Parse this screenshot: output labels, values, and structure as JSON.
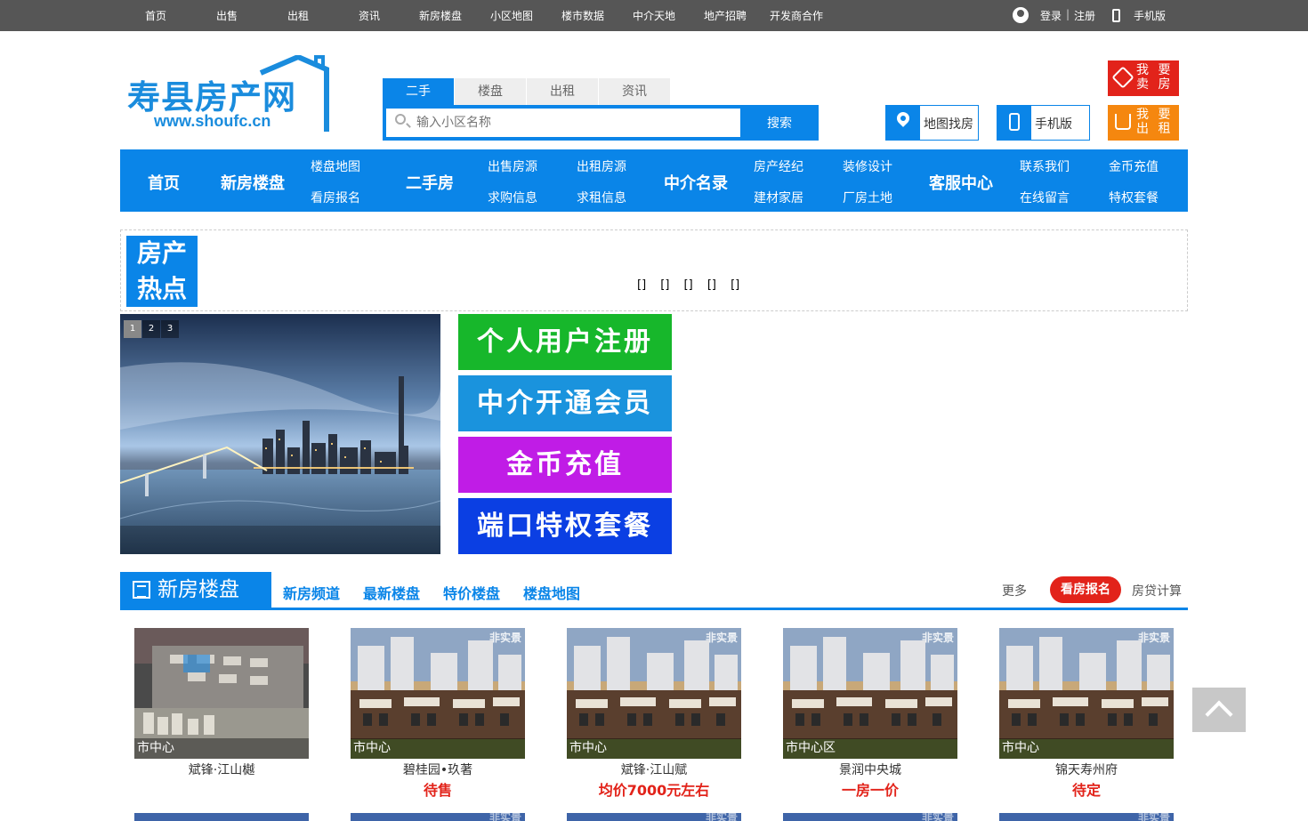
{
  "topbar": {
    "nav": [
      "首页",
      "出售",
      "出租",
      "资讯",
      "新房楼盘",
      "小区地图",
      "楼市数据",
      "中介天地",
      "地产招聘",
      "开发商合作"
    ],
    "login": "登录",
    "sep": "|",
    "register": "注册",
    "mobile": "手机版"
  },
  "logo": {
    "name": "寿县房产网",
    "url": "www.shoufc.cn"
  },
  "search": {
    "tabs": [
      "二手",
      "楼盘",
      "出租",
      "资讯"
    ],
    "active_tab": "二手",
    "placeholder": "输入小区名称",
    "button": "搜索"
  },
  "quick": {
    "map": "地图找房",
    "mobile": "手机版"
  },
  "actions": {
    "sell": [
      "我 要",
      "卖 房"
    ],
    "rent": [
      "我 要",
      "出 租"
    ]
  },
  "mainnav": {
    "home": "首页",
    "newhouse": "新房楼盘",
    "newhouse_sub": [
      "楼盘地图",
      "看房报名"
    ],
    "secondhand": "二手房",
    "secondhand_sub": [
      "出售房源",
      "求购信息",
      "出租房源",
      "求租信息"
    ],
    "agents": "中介名录",
    "agents_sub": [
      "房产经纪",
      "建材家居",
      "装修设计",
      "厂房土地"
    ],
    "service": "客服中心",
    "service_sub": [
      "联系我们",
      "在线留言",
      "金币充值",
      "特权套餐"
    ]
  },
  "hot": {
    "title_line1": "房产",
    "title_line2": "热点",
    "items": "[]  []  []  []  []"
  },
  "slider": {
    "pages": [
      "1",
      "2",
      "3"
    ]
  },
  "promos": [
    {
      "label": "个人用户注册",
      "color": "#17b72b"
    },
    {
      "label": "中介开通会员",
      "color": "#1a93dd"
    },
    {
      "label": "金币充值",
      "color": "#c01ce6"
    },
    {
      "label": "端口特权套餐",
      "color": "#0b3fe3"
    }
  ],
  "section": {
    "title": "新房楼盘",
    "tabs": [
      "新房频道",
      "最新楼盘",
      "特价楼盘",
      "楼盘地图"
    ],
    "more": "更多",
    "signup": "看房报名",
    "calc": "房贷计算"
  },
  "listings": [
    {
      "area": "市中心",
      "name": "斌锋·江山樾",
      "price": "",
      "tag": ""
    },
    {
      "area": "市中心",
      "name": "碧桂园•玖著",
      "price": "待售",
      "tag": "非实景"
    },
    {
      "area": "市中心",
      "name": "斌锋·江山赋",
      "price": "均价7000元左右",
      "tag": "非实景"
    },
    {
      "area": "市中心区",
      "name": "景润中央城",
      "price": "一房一价",
      "tag": "非实景"
    },
    {
      "area": "市中心",
      "name": "锦天寿州府",
      "price": "待定",
      "tag": "非实景"
    }
  ],
  "next_row_tag": "非实景"
}
